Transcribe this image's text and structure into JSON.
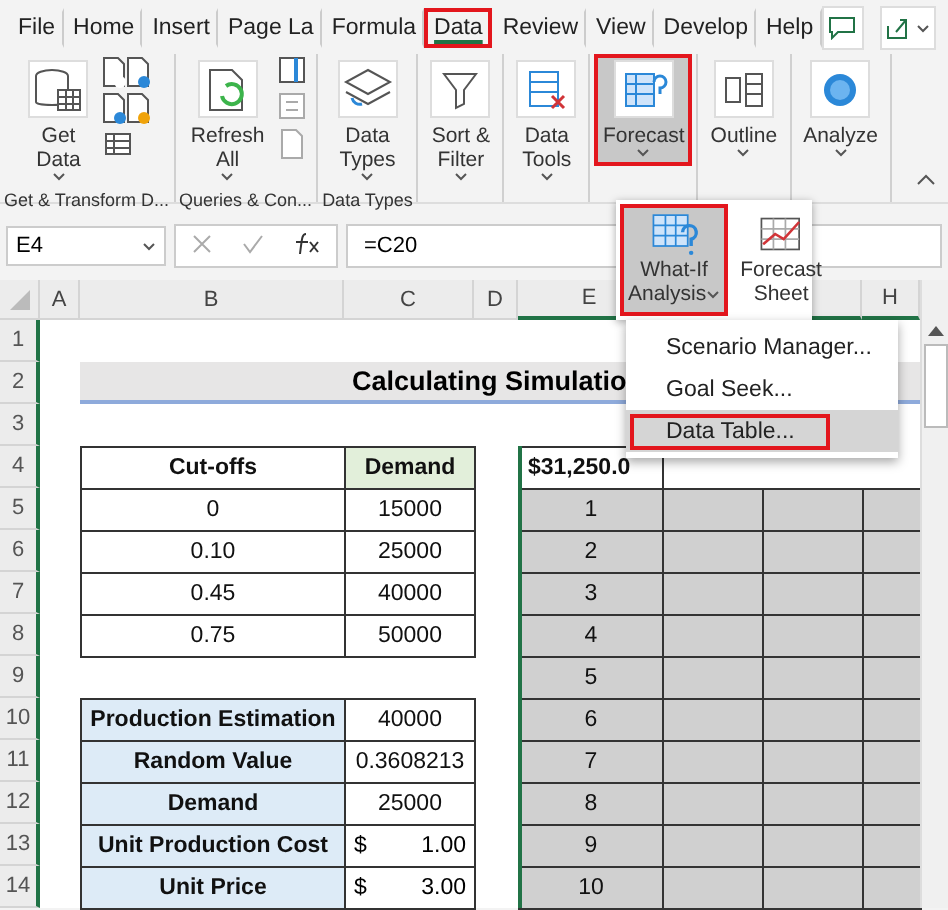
{
  "tabs": [
    {
      "label": "File",
      "selected": false,
      "highlighted": false
    },
    {
      "label": "Home",
      "selected": false,
      "highlighted": false
    },
    {
      "label": "Insert",
      "selected": false,
      "highlighted": false
    },
    {
      "label": "Page La",
      "selected": false,
      "highlighted": false
    },
    {
      "label": "Formula",
      "selected": false,
      "highlighted": false
    },
    {
      "label": "Data",
      "selected": true,
      "highlighted": true
    },
    {
      "label": "Review",
      "selected": false,
      "highlighted": false
    },
    {
      "label": "View",
      "selected": false,
      "highlighted": false
    },
    {
      "label": "Develop",
      "selected": false,
      "highlighted": false
    },
    {
      "label": "Help",
      "selected": false,
      "highlighted": false
    }
  ],
  "ribbon_groups": [
    {
      "label": "Get & Transform D...",
      "buttons": [
        {
          "kind": "database",
          "lines": [
            "Get",
            "Data"
          ],
          "dropdown": true,
          "pressed": false,
          "highlighted": false
        }
      ]
    },
    {
      "label": "Queries & Con...",
      "buttons": [
        {
          "kind": "refresh",
          "lines": [
            "Refresh",
            "All"
          ],
          "dropdown": true,
          "pressed": false,
          "highlighted": false
        }
      ]
    },
    {
      "label": "Data Types",
      "buttons": [
        {
          "kind": "layers",
          "lines": [
            "Data",
            "Types"
          ],
          "dropdown": true,
          "pressed": false,
          "highlighted": false
        }
      ]
    },
    {
      "buttons": [
        {
          "kind": "filter",
          "lines": [
            "Sort &",
            "Filter"
          ],
          "dropdown": true,
          "pressed": false,
          "highlighted": false
        }
      ]
    },
    {
      "buttons": [
        {
          "kind": "tools",
          "lines": [
            "Data",
            "Tools"
          ],
          "dropdown": true,
          "pressed": false,
          "highlighted": false
        }
      ]
    },
    {
      "buttons": [
        {
          "kind": "forecast",
          "lines": [
            "Forecast"
          ],
          "dropdown": true,
          "pressed": true,
          "highlighted": true
        }
      ]
    },
    {
      "buttons": [
        {
          "kind": "outline",
          "lines": [
            "Outline"
          ],
          "dropdown": true,
          "pressed": false,
          "highlighted": false
        }
      ]
    },
    {
      "buttons": [
        {
          "kind": "analyze",
          "lines": [
            "Analyze"
          ],
          "dropdown": true,
          "pressed": false,
          "highlighted": false
        }
      ]
    }
  ],
  "formula_bar": {
    "name_box": "E4",
    "formula": "=C20"
  },
  "columns": [
    {
      "letter": "A"
    },
    {
      "letter": "B"
    },
    {
      "letter": "C"
    },
    {
      "letter": "D"
    },
    {
      "letter": "E"
    },
    {},
    {
      "shown": true
    },
    {
      "letter": "H"
    }
  ],
  "row_numbers": [
    "1",
    "2",
    "3",
    "4",
    "5",
    "6",
    "7",
    "8",
    "9",
    "10",
    "11",
    "12",
    "13",
    "14"
  ],
  "sheet": {
    "title": "Calculating Simulatio",
    "cutoff_table": {
      "headers": [
        "Cut-offs",
        "Demand"
      ],
      "rows": [
        [
          "0",
          "15000"
        ],
        [
          "0.10",
          "25000"
        ],
        [
          "0.45",
          "40000"
        ],
        [
          "0.75",
          "50000"
        ]
      ]
    },
    "inputs": [
      {
        "label": "Production Estimation",
        "value": "40000"
      },
      {
        "label": "Random Value",
        "value": "0.3608213"
      },
      {
        "label": "Demand",
        "value": "25000"
      },
      {
        "label": "Unit Production Cost",
        "currency": "$",
        "value": "1.00"
      },
      {
        "label": "Unit Price",
        "currency": "$",
        "value": "3.00"
      }
    ],
    "data_table": {
      "corner": "$31,250.0",
      "row_inputs": [
        "1",
        "2",
        "3",
        "4",
        "5",
        "6",
        "7",
        "8",
        "9",
        "10"
      ]
    }
  },
  "forecast_panel": {
    "buttons": [
      {
        "kind": "what-if",
        "lines": [
          "What-If",
          "Analysis"
        ],
        "dropdown": true,
        "highlighted": true
      },
      {
        "kind": "forecast-sheet",
        "lines": [
          "Forecast",
          "Sheet"
        ],
        "dropdown": false,
        "highlighted": false
      }
    ]
  },
  "what_if_menu": [
    {
      "label": "Scenario Manager...",
      "selected": false,
      "highlighted": false
    },
    {
      "label": "Goal Seek...",
      "selected": false,
      "highlighted": false
    },
    {
      "label": "Data Table...",
      "selected": true,
      "highlighted": true
    }
  ]
}
